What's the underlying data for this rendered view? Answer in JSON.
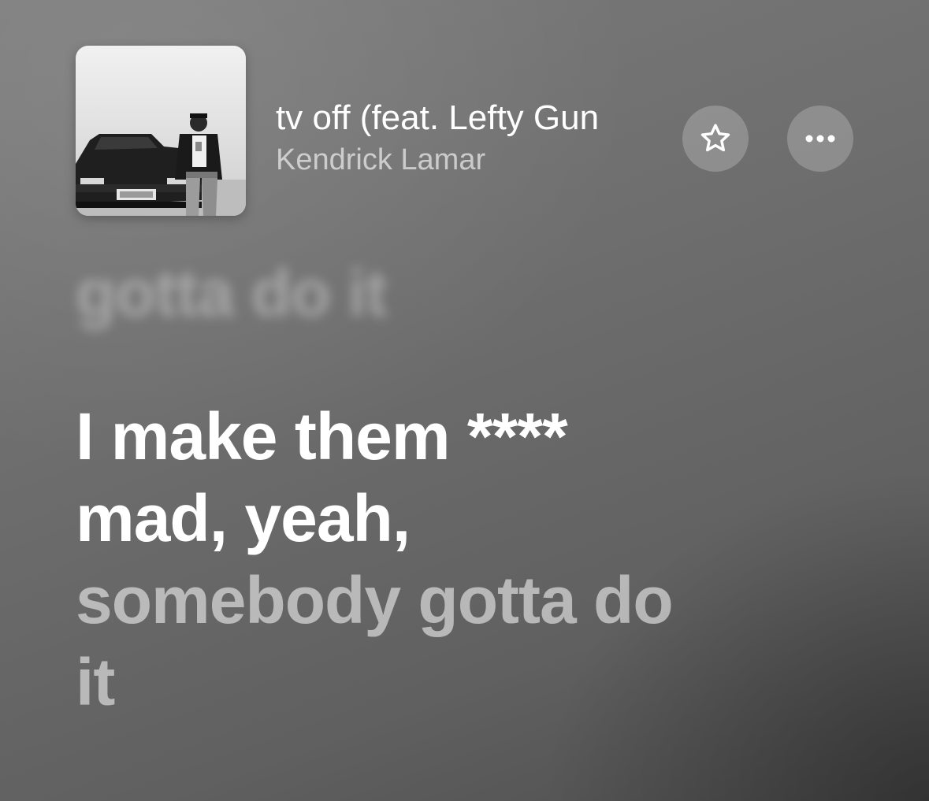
{
  "now_playing": {
    "title": "tv off (feat. Lefty Gun",
    "artist": "Kendrick Lamar",
    "artwork_icon": "album-artwork"
  },
  "controls": {
    "favorite_icon": "star-icon",
    "more_icon": "ellipsis-icon"
  },
  "lyrics": {
    "previous_line": "gotta do it",
    "current_line_sung": "I make them **** mad, yeah,",
    "current_line_upcoming": "somebody gotta do it"
  },
  "colors": {
    "background": "#6e6e6e",
    "active_text": "#ffffff",
    "inactive_text": "#b5b5b5",
    "button_fill": "#8e8e8e"
  }
}
